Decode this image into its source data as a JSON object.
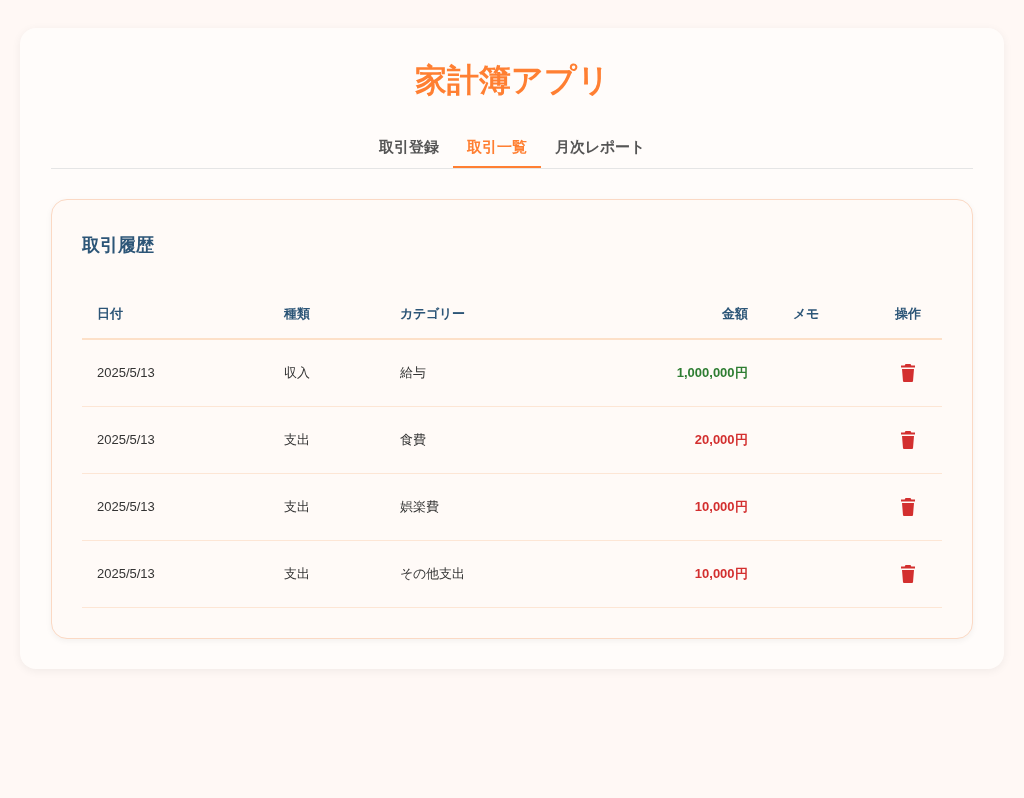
{
  "app": {
    "title": "家計簿アプリ"
  },
  "tabs": [
    {
      "label": "取引登録",
      "selected": false
    },
    {
      "label": "取引一覧",
      "selected": true
    },
    {
      "label": "月次レポート",
      "selected": false
    }
  ],
  "history": {
    "title": "取引履歴",
    "columns": [
      "日付",
      "種類",
      "カテゴリー",
      "金額",
      "メモ",
      "操作"
    ],
    "rows": [
      {
        "date": "2025/5/13",
        "type": "収入",
        "kind": "income",
        "category": "給与",
        "amount": "1,000,000円"
      },
      {
        "date": "2025/5/13",
        "type": "支出",
        "kind": "expense",
        "category": "食費",
        "amount": "20,000円"
      },
      {
        "date": "2025/5/13",
        "type": "支出",
        "kind": "expense",
        "category": "娯楽費",
        "amount": "10,000円"
      },
      {
        "date": "2025/5/13",
        "type": "支出",
        "kind": "expense",
        "category": "その他支出",
        "amount": "10,000円"
      }
    ]
  }
}
